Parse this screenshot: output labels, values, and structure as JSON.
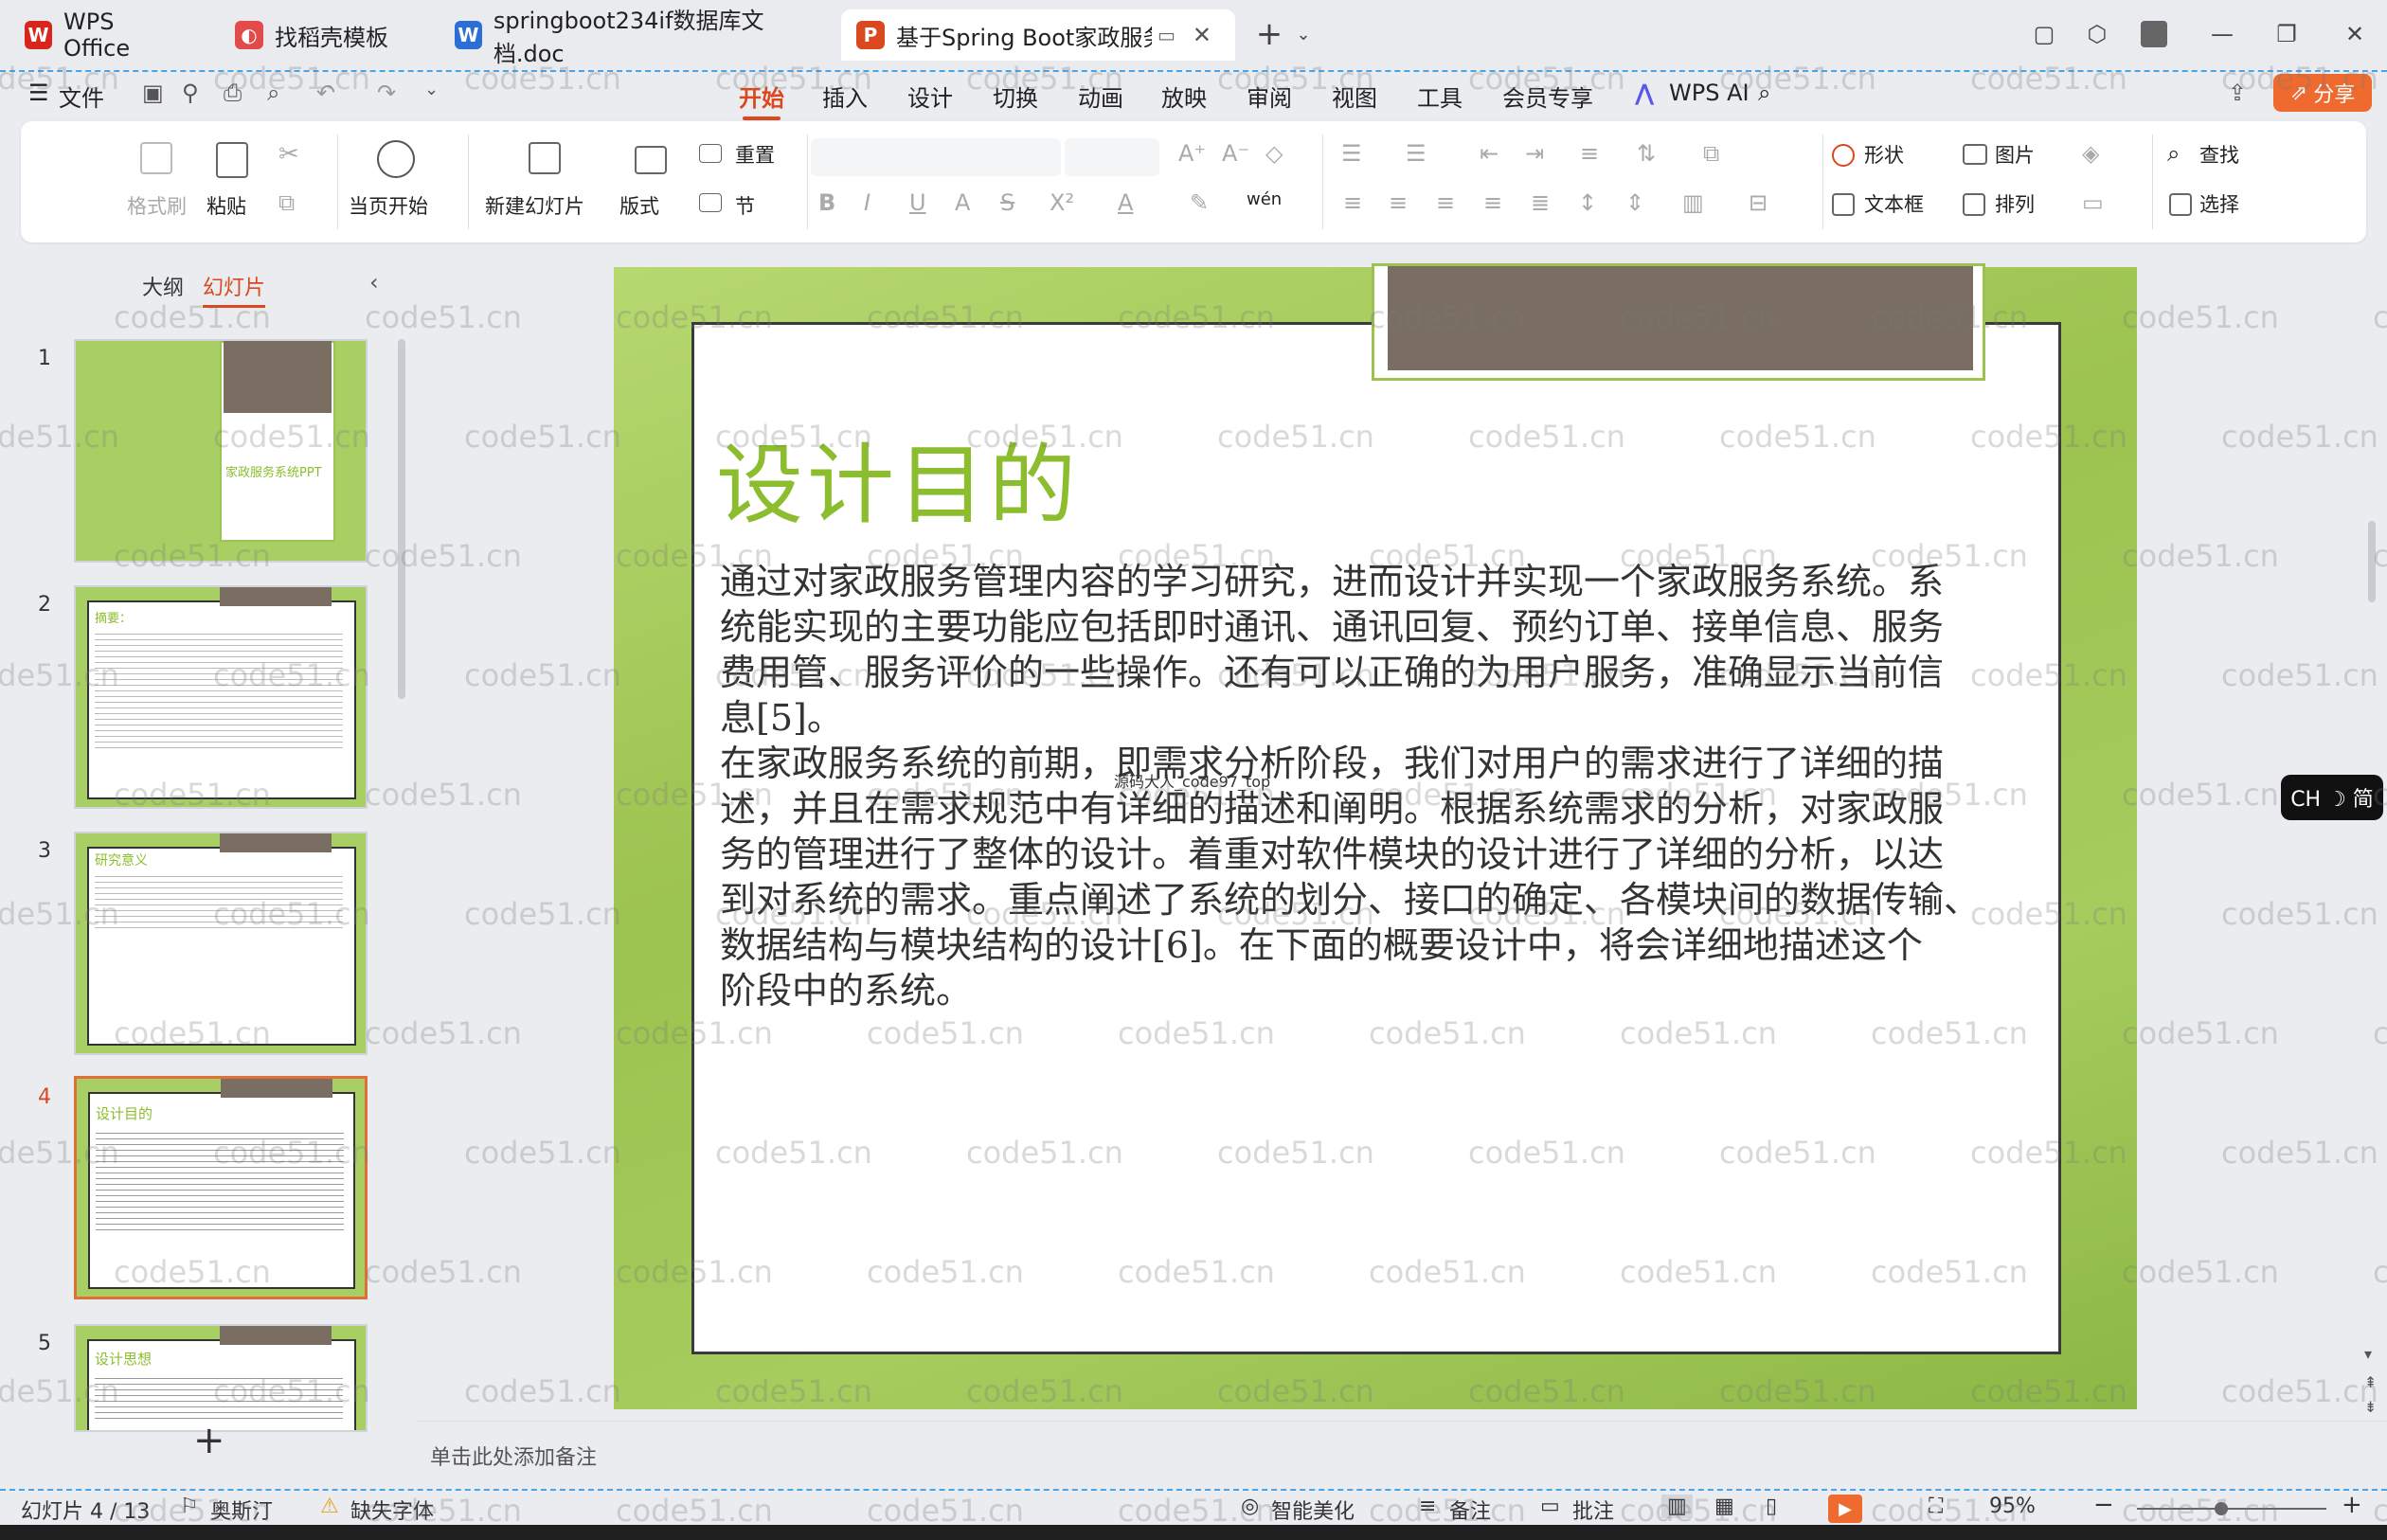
{
  "tabs": [
    {
      "label": "WPS Office"
    },
    {
      "label": "找稻壳模板"
    },
    {
      "label": "springboot234if数据库文档.doc"
    },
    {
      "label": "基于Spring Boot家政服务系"
    }
  ],
  "menu": {
    "file": "文件",
    "items": [
      "开始",
      "插入",
      "设计",
      "切换",
      "动画",
      "放映",
      "审阅",
      "视图",
      "工具",
      "会员专享",
      "WPS AI"
    ],
    "share": "分享"
  },
  "ribbon": {
    "format_painter": "格式刷",
    "paste": "粘贴",
    "from_current": "当页开始",
    "new_slide": "新建幻灯片",
    "layout": "版式",
    "reset": "重置",
    "section": "节",
    "shape": "形状",
    "picture": "图片",
    "textbox": "文本框",
    "arrange": "排列",
    "find": "查找",
    "select": "选择"
  },
  "panel": {
    "outline_tab": "大纲",
    "slides_tab": "幻灯片",
    "thumb1_text": "家政服务系统PPT",
    "thumb2_title": "摘要：",
    "thumb3_title": "研究意义",
    "thumb4_title": "设计目的",
    "thumb5_title": "设计思想",
    "slide_numbers": [
      "1",
      "2",
      "3",
      "4",
      "5"
    ]
  },
  "slide": {
    "title": "设计目的",
    "watermark_line": "源码大人_code97_top",
    "lines": [
      "通过对家政服务管理内容的学习研究，进而设计并实现一个家政服务系统。系",
      "统能实现的主要功能应包括即时通讯、通讯回复、预约订单、接单信息、服务",
      "费用管、服务评价的一些操作。还有可以正确的为用户服务，准确显示当前信",
      "息[5]。",
      "在家政服务系统的前期，即需求分析阶段，我们对用户的需求进行了详细的描",
      "述，并且在需求规范中有详细的描述和阐明。根据系统需求的分析，对家政服",
      "务的管理进行了整体的设计。着重对软件模块的设计进行了详细的分析，以达",
      "到对系统的需求。重点阐述了系统的划分、接口的确定、各模块间的数据传输、",
      "数据结构与模块结构的设计[6]。在下面的概要设计中，将会详细地描述这个",
      "阶段中的系统。"
    ]
  },
  "notes_placeholder": "单击此处添加备注",
  "status": {
    "slide_info": "幻灯片 4 / 13",
    "theme": "奥斯汀",
    "missing_font": "缺失字体",
    "beautify": "智能美化",
    "notes": "备注",
    "comments": "批注",
    "zoom": "95%"
  },
  "ime": "CH ☽ 简",
  "watermark": "code51.cn"
}
